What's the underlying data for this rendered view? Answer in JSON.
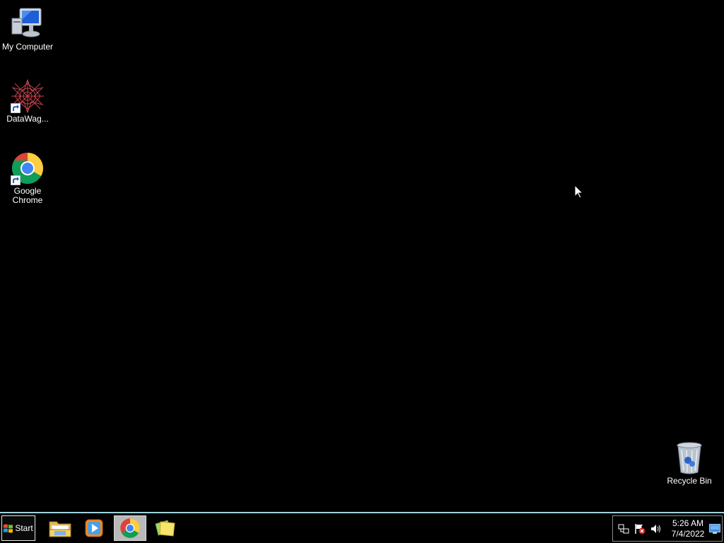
{
  "desktop": {
    "icons": {
      "my_computer": "My Computer",
      "datawag": "DataWag...",
      "chrome": "Google\nChrome",
      "recycle_bin": "Recycle Bin"
    }
  },
  "taskbar": {
    "start_label": "Start",
    "pinned": [
      {
        "name": "Windows Explorer",
        "icon": "folder-icon"
      },
      {
        "name": "Windows Media Player",
        "icon": "media-player-icon"
      },
      {
        "name": "Google Chrome",
        "icon": "chrome-icon",
        "active": true
      },
      {
        "name": "Sticky Notes",
        "icon": "sticky-notes-icon"
      }
    ],
    "tray": {
      "icons": [
        "network-icon",
        "action-center-icon",
        "volume-icon"
      ],
      "time": "5:26 AM",
      "date": "7/4/2022"
    }
  },
  "colors": {
    "background": "#000000",
    "taskbar_border": "#9fd2dc",
    "active_button": "#b9b9b9"
  }
}
